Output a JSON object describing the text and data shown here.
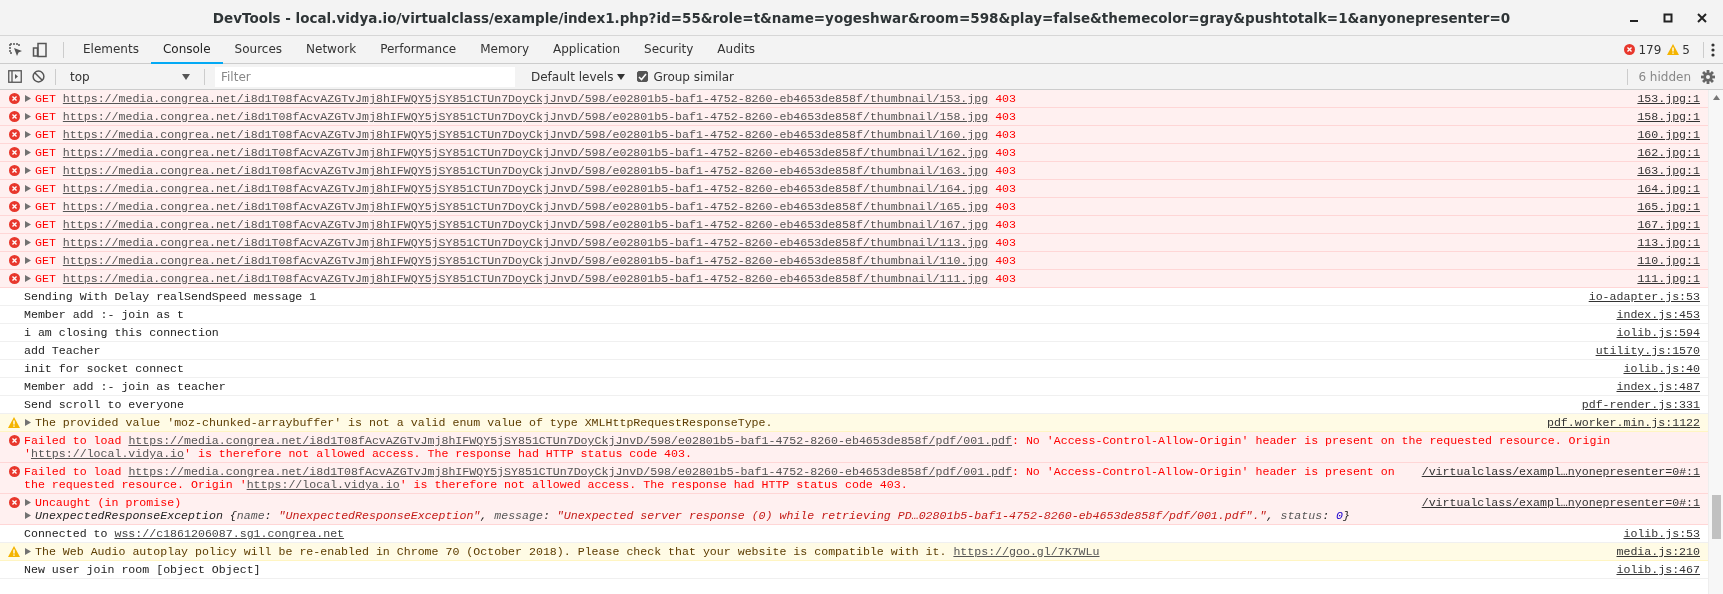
{
  "window": {
    "title": "DevTools - local.vidya.io/virtualclass/example/index1.php?id=55&role=t&name=yogeshwar&room=598&play=false&themecolor=gray&pushtotalk=1&anyonepresenter=0"
  },
  "tabs": [
    {
      "label": "Elements",
      "selected": false
    },
    {
      "label": "Console",
      "selected": true
    },
    {
      "label": "Sources",
      "selected": false
    },
    {
      "label": "Network",
      "selected": false
    },
    {
      "label": "Performance",
      "selected": false
    },
    {
      "label": "Memory",
      "selected": false
    },
    {
      "label": "Application",
      "selected": false
    },
    {
      "label": "Security",
      "selected": false
    },
    {
      "label": "Audits",
      "selected": false
    }
  ],
  "counts": {
    "errors": "179",
    "warnings": "5"
  },
  "toolbar": {
    "context": "top",
    "filter": {
      "placeholder": "Filter"
    },
    "levels": "Default levels",
    "group_similar": {
      "label": "Group similar",
      "checked": true
    },
    "hidden": "6 hidden"
  },
  "messages": [
    {
      "kind": "network",
      "expanded": false,
      "method": "GET",
      "url": "https://media.congrea.net/i8d1T08fAcvAZGTvJmj8hIFWQY5jSY851CTUn7DoyCkjJnvD/598/e02801b5-baf1-4752-8260-eb4653de858f/thumbnail/153.jpg",
      "status": "403",
      "source": "153.jpg:1"
    },
    {
      "kind": "network",
      "expanded": false,
      "method": "GET",
      "url": "https://media.congrea.net/i8d1T08fAcvAZGTvJmj8hIFWQY5jSY851CTUn7DoyCkjJnvD/598/e02801b5-baf1-4752-8260-eb4653de858f/thumbnail/158.jpg",
      "status": "403",
      "source": "158.jpg:1"
    },
    {
      "kind": "network",
      "expanded": false,
      "method": "GET",
      "url": "https://media.congrea.net/i8d1T08fAcvAZGTvJmj8hIFWQY5jSY851CTUn7DoyCkjJnvD/598/e02801b5-baf1-4752-8260-eb4653de858f/thumbnail/160.jpg",
      "status": "403",
      "source": "160.jpg:1"
    },
    {
      "kind": "network",
      "expanded": false,
      "method": "GET",
      "url": "https://media.congrea.net/i8d1T08fAcvAZGTvJmj8hIFWQY5jSY851CTUn7DoyCkjJnvD/598/e02801b5-baf1-4752-8260-eb4653de858f/thumbnail/162.jpg",
      "status": "403",
      "source": "162.jpg:1"
    },
    {
      "kind": "network",
      "expanded": false,
      "method": "GET",
      "url": "https://media.congrea.net/i8d1T08fAcvAZGTvJmj8hIFWQY5jSY851CTUn7DoyCkjJnvD/598/e02801b5-baf1-4752-8260-eb4653de858f/thumbnail/163.jpg",
      "status": "403",
      "source": "163.jpg:1"
    },
    {
      "kind": "network",
      "expanded": false,
      "method": "GET",
      "url": "https://media.congrea.net/i8d1T08fAcvAZGTvJmj8hIFWQY5jSY851CTUn7DoyCkjJnvD/598/e02801b5-baf1-4752-8260-eb4653de858f/thumbnail/164.jpg",
      "status": "403",
      "source": "164.jpg:1"
    },
    {
      "kind": "network",
      "expanded": false,
      "method": "GET",
      "url": "https://media.congrea.net/i8d1T08fAcvAZGTvJmj8hIFWQY5jSY851CTUn7DoyCkjJnvD/598/e02801b5-baf1-4752-8260-eb4653de858f/thumbnail/165.jpg",
      "status": "403",
      "source": "165.jpg:1"
    },
    {
      "kind": "network",
      "expanded": false,
      "method": "GET",
      "url": "https://media.congrea.net/i8d1T08fAcvAZGTvJmj8hIFWQY5jSY851CTUn7DoyCkjJnvD/598/e02801b5-baf1-4752-8260-eb4653de858f/thumbnail/167.jpg",
      "status": "403",
      "source": "167.jpg:1"
    },
    {
      "kind": "network",
      "expanded": false,
      "method": "GET",
      "url": "https://media.congrea.net/i8d1T08fAcvAZGTvJmj8hIFWQY5jSY851CTUn7DoyCkjJnvD/598/e02801b5-baf1-4752-8260-eb4653de858f/thumbnail/113.jpg",
      "status": "403",
      "source": "113.jpg:1"
    },
    {
      "kind": "network",
      "expanded": false,
      "method": "GET",
      "url": "https://media.congrea.net/i8d1T08fAcvAZGTvJmj8hIFWQY5jSY851CTUn7DoyCkjJnvD/598/e02801b5-baf1-4752-8260-eb4653de858f/thumbnail/110.jpg",
      "status": "403",
      "source": "110.jpg:1"
    },
    {
      "kind": "network",
      "expanded": false,
      "method": "GET",
      "url": "https://media.congrea.net/i8d1T08fAcvAZGTvJmj8hIFWQY5jSY851CTUn7DoyCkjJnvD/598/e02801b5-baf1-4752-8260-eb4653de858f/thumbnail/111.jpg",
      "status": "403",
      "source": "111.jpg:1"
    },
    {
      "kind": "log",
      "segments": [
        {
          "kind": "text",
          "text": "Sending With Delay realSendSpeed message 1"
        }
      ],
      "source": "io-adapter.js:53"
    },
    {
      "kind": "log",
      "segments": [
        {
          "kind": "text",
          "text": "Member add :- join as t"
        }
      ],
      "source": "index.js:453"
    },
    {
      "kind": "log",
      "segments": [
        {
          "kind": "text",
          "text": "i am closing this connection"
        }
      ],
      "source": "iolib.js:594"
    },
    {
      "kind": "log",
      "segments": [
        {
          "kind": "text",
          "text": "add Teacher"
        }
      ],
      "source": "utility.js:1570"
    },
    {
      "kind": "log",
      "segments": [
        {
          "kind": "text",
          "text": "init for socket connect"
        }
      ],
      "source": "iolib.js:40"
    },
    {
      "kind": "log",
      "segments": [
        {
          "kind": "text",
          "text": "Member add :- join as teacher"
        }
      ],
      "source": "index.js:487"
    },
    {
      "kind": "log",
      "segments": [
        {
          "kind": "text",
          "text": "Send scroll to everyone"
        }
      ],
      "source": "pdf-render.js:331"
    },
    {
      "kind": "warning",
      "expanded": false,
      "segments": [
        {
          "kind": "text",
          "text": "The provided value 'moz-chunked-arraybuffer' is not a valid enum value of type XMLHttpRequestResponseType."
        }
      ],
      "source": "pdf.worker.min.js:1122"
    },
    {
      "kind": "error",
      "segments": [
        {
          "kind": "text",
          "text": "Failed to load "
        },
        {
          "kind": "link",
          "text": "https://media.congrea.net/i8d1T08fAcvAZGTvJmj8hIFWQY5jSY851CTUn7DoyCkjJnvD/598/e02801b5-baf1-4752-8260-eb4653de858f/pdf/001.pdf"
        },
        {
          "kind": "text",
          "text": ": No 'Access-Control-Allow-Origin' header is present on the requested resource. Origin '"
        },
        {
          "kind": "link",
          "text": "https://local.vidya.io"
        },
        {
          "kind": "text",
          "text": "' is therefore not allowed access. The response had HTTP status code 403."
        }
      ]
    },
    {
      "kind": "error",
      "segments": [
        {
          "kind": "text",
          "text": "Failed to load "
        },
        {
          "kind": "link",
          "text": "https://media.congrea.net/i8d1T08fAcvAZGTvJmj8hIFWQY5jSY851CTUn7DoyCkjJnvD/598/e02801b5-baf1-4752-8260-eb4653de858f/pdf/001.pdf"
        },
        {
          "kind": "text",
          "text": ": No 'Access-Control-Allow-Origin' header is present on the requested resource. Origin '"
        },
        {
          "kind": "link",
          "text": "https://local.vidya.io"
        },
        {
          "kind": "text",
          "text": "' is therefore not allowed access. The response had HTTP status code 403."
        }
      ],
      "source": "/virtualclass/exampl…nyonepresenter=0#:1"
    },
    {
      "kind": "uncaught",
      "expanded": false,
      "segments": [
        {
          "kind": "text",
          "text": "Uncaught (in promise)"
        }
      ],
      "source": "/virtualclass/exampl…nyonepresenter=0#:1",
      "object": {
        "expanded": false,
        "segments": [
          {
            "kind": "text",
            "text": "UnexpectedResponseException {"
          },
          {
            "kind": "key",
            "text": "name"
          },
          {
            "kind": "text",
            "text": ": "
          },
          {
            "kind": "string",
            "text": "\"UnexpectedResponseException\""
          },
          {
            "kind": "text",
            "text": ", "
          },
          {
            "kind": "key",
            "text": "message"
          },
          {
            "kind": "text",
            "text": ": "
          },
          {
            "kind": "string",
            "text": "\"Unexpected server response (0) while retrieving PD…02801b5-baf1-4752-8260-eb4653de858f/pdf/001.pdf\".\""
          },
          {
            "kind": "text",
            "text": ", "
          },
          {
            "kind": "key",
            "text": "status"
          },
          {
            "kind": "text",
            "text": ": "
          },
          {
            "kind": "number",
            "text": "0"
          },
          {
            "kind": "text",
            "text": "}"
          }
        ]
      }
    },
    {
      "kind": "log",
      "segments": [
        {
          "kind": "text",
          "text": "Connected to "
        },
        {
          "kind": "link",
          "text": "wss://c1861206087.sg1.congrea.net"
        }
      ],
      "source": "iolib.js:53"
    },
    {
      "kind": "warning",
      "expanded": false,
      "segments": [
        {
          "kind": "text",
          "text": "The Web Audio autoplay policy will be re-enabled in Chrome 70 (October 2018). Please check that your website is compatible with it. "
        },
        {
          "kind": "link",
          "text": "https://goo.gl/7K7WLu"
        }
      ],
      "source": "media.js:210"
    },
    {
      "kind": "log",
      "segments": [
        {
          "kind": "text",
          "text": "New user join room [object Object]"
        }
      ],
      "source": "iolib.js:467"
    }
  ]
}
